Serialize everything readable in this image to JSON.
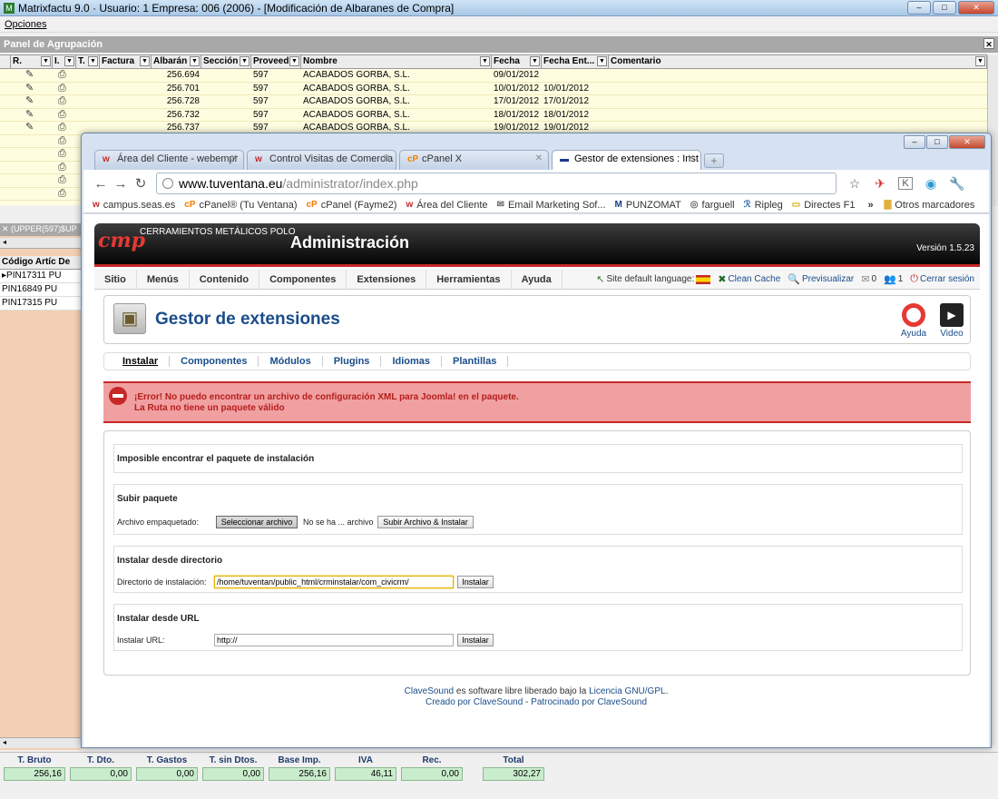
{
  "app": {
    "title": "Matrixfactu 9.0 · Usuario: 1 Empresa: 006 (2006) - [Modificación de Albaranes de Compra]",
    "menu_opciones": "Opciones",
    "panel_title": "Panel de Agrupación"
  },
  "grid": {
    "headers": [
      "R.",
      "I.",
      "T.",
      "Factura",
      "Albarán",
      "Sección",
      "Proveedor",
      "Nombre",
      "Fecha",
      "Fecha Ent...",
      "Comentario"
    ],
    "rows": [
      {
        "albaran": "256.694",
        "prov": "597",
        "nombre": "ACABADOS GORBA, S.L.",
        "fecha": "09/01/2012",
        "fecha_ent": ""
      },
      {
        "albaran": "256.701",
        "prov": "597",
        "nombre": "ACABADOS GORBA, S.L.",
        "fecha": "10/01/2012",
        "fecha_ent": "10/01/2012"
      },
      {
        "albaran": "256.728",
        "prov": "597",
        "nombre": "ACABADOS GORBA, S.L.",
        "fecha": "17/01/2012",
        "fecha_ent": "17/01/2012"
      },
      {
        "albaran": "256.732",
        "prov": "597",
        "nombre": "ACABADOS GORBA, S.L.",
        "fecha": "18/01/2012",
        "fecha_ent": "18/01/2012"
      },
      {
        "albaran": "256.737",
        "prov": "597",
        "nombre": "ACABADOS GORBA, S.L.",
        "fecha": "19/01/2012",
        "fecha_ent": "19/01/2012"
      }
    ]
  },
  "left_panel": {
    "filter": "(UPPER(597)$UP",
    "headers": [
      "Código Artíc",
      "De"
    ],
    "rows": [
      {
        "codigo": "PIN17311",
        "de": "PU"
      },
      {
        "codigo": "PIN16849",
        "de": "PU"
      },
      {
        "codigo": "PIN17315",
        "de": "PU"
      }
    ]
  },
  "totals": [
    {
      "label": "T. Bruto",
      "value": "256,16"
    },
    {
      "label": "T. Dto.",
      "value": "0,00"
    },
    {
      "label": "T. Gastos",
      "value": "0,00"
    },
    {
      "label": "T. sin Dtos.",
      "value": "0,00"
    },
    {
      "label": "Base Imp.",
      "value": "256,16"
    },
    {
      "label": "IVA",
      "value": "46,11"
    },
    {
      "label": "Rec.",
      "value": "0,00"
    },
    {
      "label": "Total",
      "value": "302,27"
    }
  ],
  "browser": {
    "tabs": [
      {
        "label": "Área del Cliente - webempr",
        "favicon": "u"
      },
      {
        "label": "Control Visitas de Comercia",
        "favicon": "u"
      },
      {
        "label": "cPanel X",
        "favicon": "cP"
      },
      {
        "label": "Gestor de extensiones : Inst",
        "favicon": "joomla"
      }
    ],
    "url_host": "www.tuventana.eu",
    "url_path": "/administrator/index.php",
    "bookmarks": [
      {
        "label": "campus.seas.es",
        "icon": "u"
      },
      {
        "label": "cPanel® (Tu Ventana)",
        "icon": "cP"
      },
      {
        "label": "cPanel (Fayme2)",
        "icon": "cP"
      },
      {
        "label": "Área del Cliente",
        "icon": "u"
      },
      {
        "label": "Email Marketing Sof...",
        "icon": "mail"
      },
      {
        "label": "PUNZOMAT",
        "icon": "M"
      },
      {
        "label": "farguell",
        "icon": "grey"
      },
      {
        "label": "Ripleg",
        "icon": "ripleg"
      },
      {
        "label": "Directes F1",
        "icon": "dir"
      }
    ],
    "bookmarks_more": "»",
    "other_bookmarks": "Otros marcadores"
  },
  "joomla": {
    "company": "CERRAMIENTOS METÁLICOS POLO",
    "admin_title": "Administración",
    "version": "Versión 1.5.23",
    "menu": [
      "Sitio",
      "Menús",
      "Contenido",
      "Componentes",
      "Extensiones",
      "Herramientas",
      "Ayuda"
    ],
    "status": {
      "site_lang": "Site default language:",
      "clean_cache": "Clean Cache",
      "preview": "Previsualizar",
      "messages": "0",
      "users": "1",
      "logout": "Cerrar sesión"
    },
    "page_title": "Gestor de extensiones",
    "btn_help": "Ayuda",
    "btn_video": "Video",
    "subtabs": [
      "Instalar",
      "Componentes",
      "Módulos",
      "Plugins",
      "Idiomas",
      "Plantillas"
    ],
    "error_line1": "¡Error! No puedo encontrar un archivo de configuración XML para Joomla! en el paquete.",
    "error_line2": "La Ruta no tiene un paquete válido",
    "section_noinstall": "Imposible encontrar el paquete de instalación",
    "upload": {
      "title": "Subir paquete",
      "label": "Archivo empaquetado:",
      "choose_btn": "Seleccionar archivo",
      "no_file": "No se ha ... archivo",
      "submit_btn": "Subir Archivo & Instalar"
    },
    "dir": {
      "title": "Instalar desde directorio",
      "label": "Directorio de instalación:",
      "value": "/home/tuventan/public_html/crminstalar/com_civicrm/",
      "btn": "Instalar"
    },
    "url": {
      "title": "Instalar desde URL",
      "label": "Instalar URL:",
      "value": "http://",
      "btn": "Instalar"
    },
    "footer": {
      "f1a": "ClaveSound",
      "f1b": " es software libre liberado bajo la ",
      "f1c": "Licencia GNU/GPL",
      "f1d": ".",
      "f2a": "Creado por ClaveSound",
      "f2b": " - ",
      "f2c": "Patrocinado por ClaveSound"
    }
  }
}
